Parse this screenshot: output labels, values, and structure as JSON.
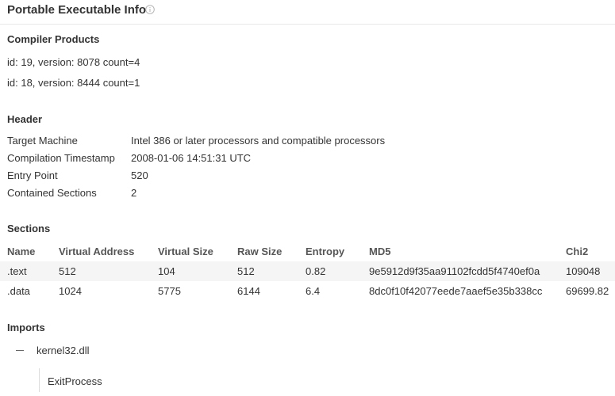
{
  "header": {
    "title": "Portable Executable Info"
  },
  "compiler_products": {
    "title": "Compiler Products",
    "items": [
      "id: 19, version: 8078 count=4",
      "id: 18, version: 8444 count=1"
    ]
  },
  "pe_header": {
    "title": "Header",
    "rows": [
      {
        "label": "Target Machine",
        "value": "Intel 386 or later processors and compatible processors"
      },
      {
        "label": "Compilation Timestamp",
        "value": "2008-01-06 14:51:31 UTC"
      },
      {
        "label": "Entry Point",
        "value": "520"
      },
      {
        "label": "Contained Sections",
        "value": "2"
      }
    ]
  },
  "sections": {
    "title": "Sections",
    "columns": [
      "Name",
      "Virtual Address",
      "Virtual Size",
      "Raw Size",
      "Entropy",
      "MD5",
      "Chi2"
    ],
    "rows": [
      [
        ".text",
        "512",
        "104",
        "512",
        "0.82",
        "9e5912d9f35aa91102fcdd5f4740ef0a",
        "109048"
      ],
      [
        ".data",
        "1024",
        "5775",
        "6144",
        "6.4",
        "8dc0f10f42077eede7aaef5e35b338cc",
        "69699.82"
      ]
    ]
  },
  "imports": {
    "title": "Imports",
    "dlls": [
      {
        "name": "kernel32.dll",
        "functions": [
          "ExitProcess"
        ]
      }
    ]
  },
  "icons": {
    "info": "info-circle-icon",
    "collapse": "minus-collapse-icon"
  }
}
